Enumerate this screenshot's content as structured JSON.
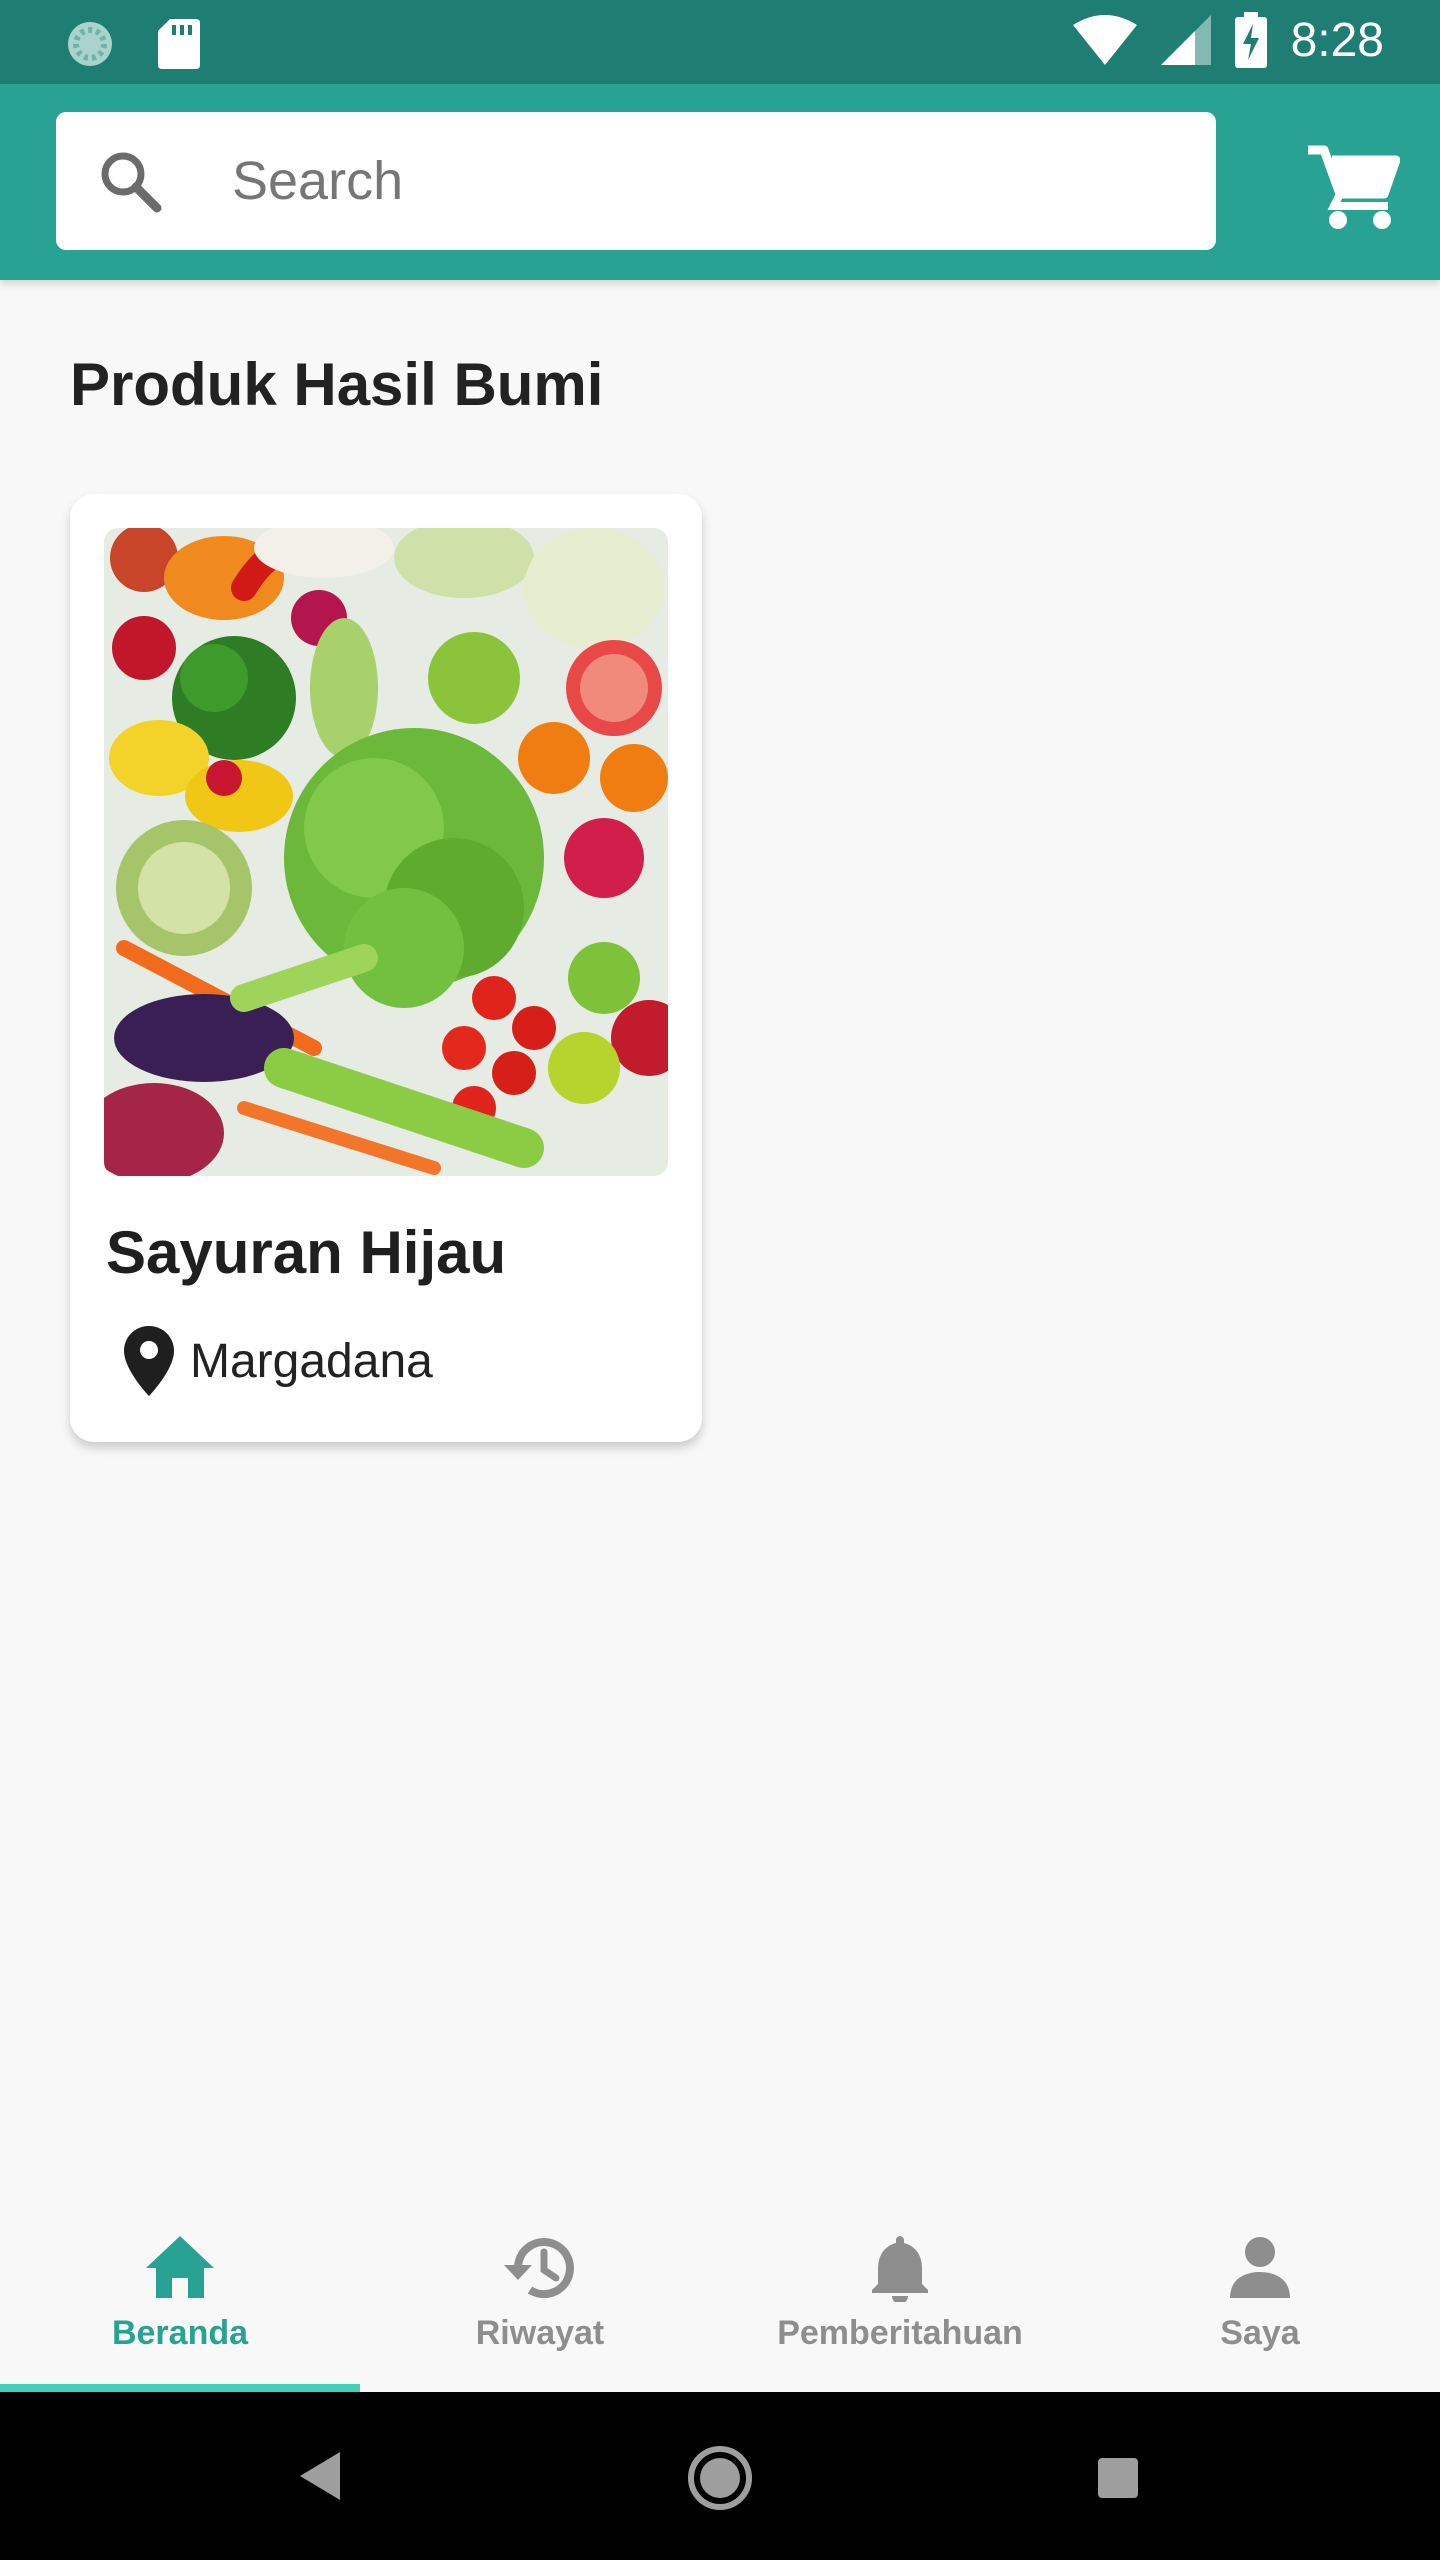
{
  "status_bar": {
    "time": "8:28",
    "icons": [
      "loading-icon",
      "sd-card-icon",
      "wifi-icon",
      "signal-icon",
      "battery-charging-icon"
    ]
  },
  "header": {
    "search": {
      "placeholder": "Search"
    },
    "cart_icon": "cart-icon",
    "colors": {
      "bar": "#27a293",
      "status": "#1f7e74"
    }
  },
  "main": {
    "section_title": "Produk Hasil Bumi",
    "products": [
      {
        "name": "Sayuran Hijau",
        "location": "Margadana",
        "image": "vegetables-photo"
      }
    ]
  },
  "bottom_nav": {
    "items": [
      {
        "label": "Beranda",
        "icon": "home-icon",
        "active": true
      },
      {
        "label": "Riwayat",
        "icon": "history-icon",
        "active": false
      },
      {
        "label": "Pemberitahuan",
        "icon": "bell-icon",
        "active": false
      },
      {
        "label": "Saya",
        "icon": "person-icon",
        "active": false
      }
    ],
    "active_color": "#27a293",
    "inactive_color": "#8e8e8e"
  },
  "system_nav": {
    "buttons": [
      "back-button",
      "home-button",
      "recents-button"
    ]
  }
}
